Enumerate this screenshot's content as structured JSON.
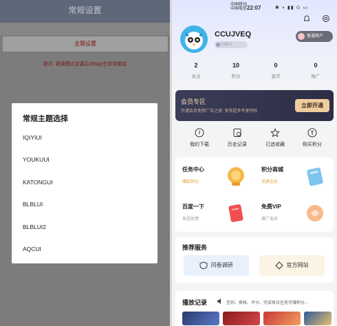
{
  "left": {
    "topbar_title": "常规设置",
    "button_label": "主题设置",
    "hint_text": "提示: 更换模式设置后对App生效请重启",
    "dialog": {
      "title": "常规主题选择",
      "items": [
        "IQIYIUI",
        "YOUKUUI",
        "KATONGUI",
        "BLBLUI",
        "BLBLUI2",
        "AQCUI"
      ]
    }
  },
  "right": {
    "status": {
      "carrier_line1": "中国移动",
      "carrier_line2": "中国电信",
      "time": "22:07",
      "icons": "✱ ◖ ▮▮ ⊙ ▭"
    },
    "profile": {
      "username": "CCUJVEQ",
      "level": "LV0.1",
      "vip_pill": "普通用户"
    },
    "stats": [
      {
        "value": "2",
        "label": "关注"
      },
      {
        "value": "10",
        "label": "积分"
      },
      {
        "value": "0",
        "label": "金币"
      },
      {
        "value": "0",
        "label": "推广"
      }
    ],
    "vip_banner": {
      "title": "会员专区",
      "desc": "开通会员免除广告之烦, 享受超多专享特权",
      "button": "立即开通"
    },
    "quick_actions": [
      {
        "label": "我的下载",
        "icon": "download-icon"
      },
      {
        "label": "历史记录",
        "icon": "history-icon"
      },
      {
        "label": "已追收藏",
        "icon": "star-icon"
      },
      {
        "label": "购买积分",
        "icon": "points-icon"
      }
    ],
    "cards": [
      {
        "title": "任务中心",
        "sub": "赚取积分",
        "sub_color": "#e6a23c",
        "icon": "task-icon"
      },
      {
        "title": "积分商城",
        "sub": "兑换会员",
        "sub_color": "#e6a23c",
        "icon": "mall-icon"
      },
      {
        "title": "百度一下",
        "sub": "发送反馈",
        "sub_color": "#999999",
        "icon": "search-card-icon"
      },
      {
        "title": "免费VIP",
        "sub": "推广会员",
        "sub_color": "#999999",
        "icon": "gift-icon"
      }
    ],
    "services": {
      "title": "推荐服务",
      "items": [
        {
          "label": "问卷调研",
          "icon": "heart-shield-icon"
        },
        {
          "label": "官方网站",
          "icon": "diamond-icon"
        }
      ]
    },
    "history": {
      "title": "播放记录",
      "note": "签到、换帐、评分、完成每日任务可赚积分..."
    }
  }
}
